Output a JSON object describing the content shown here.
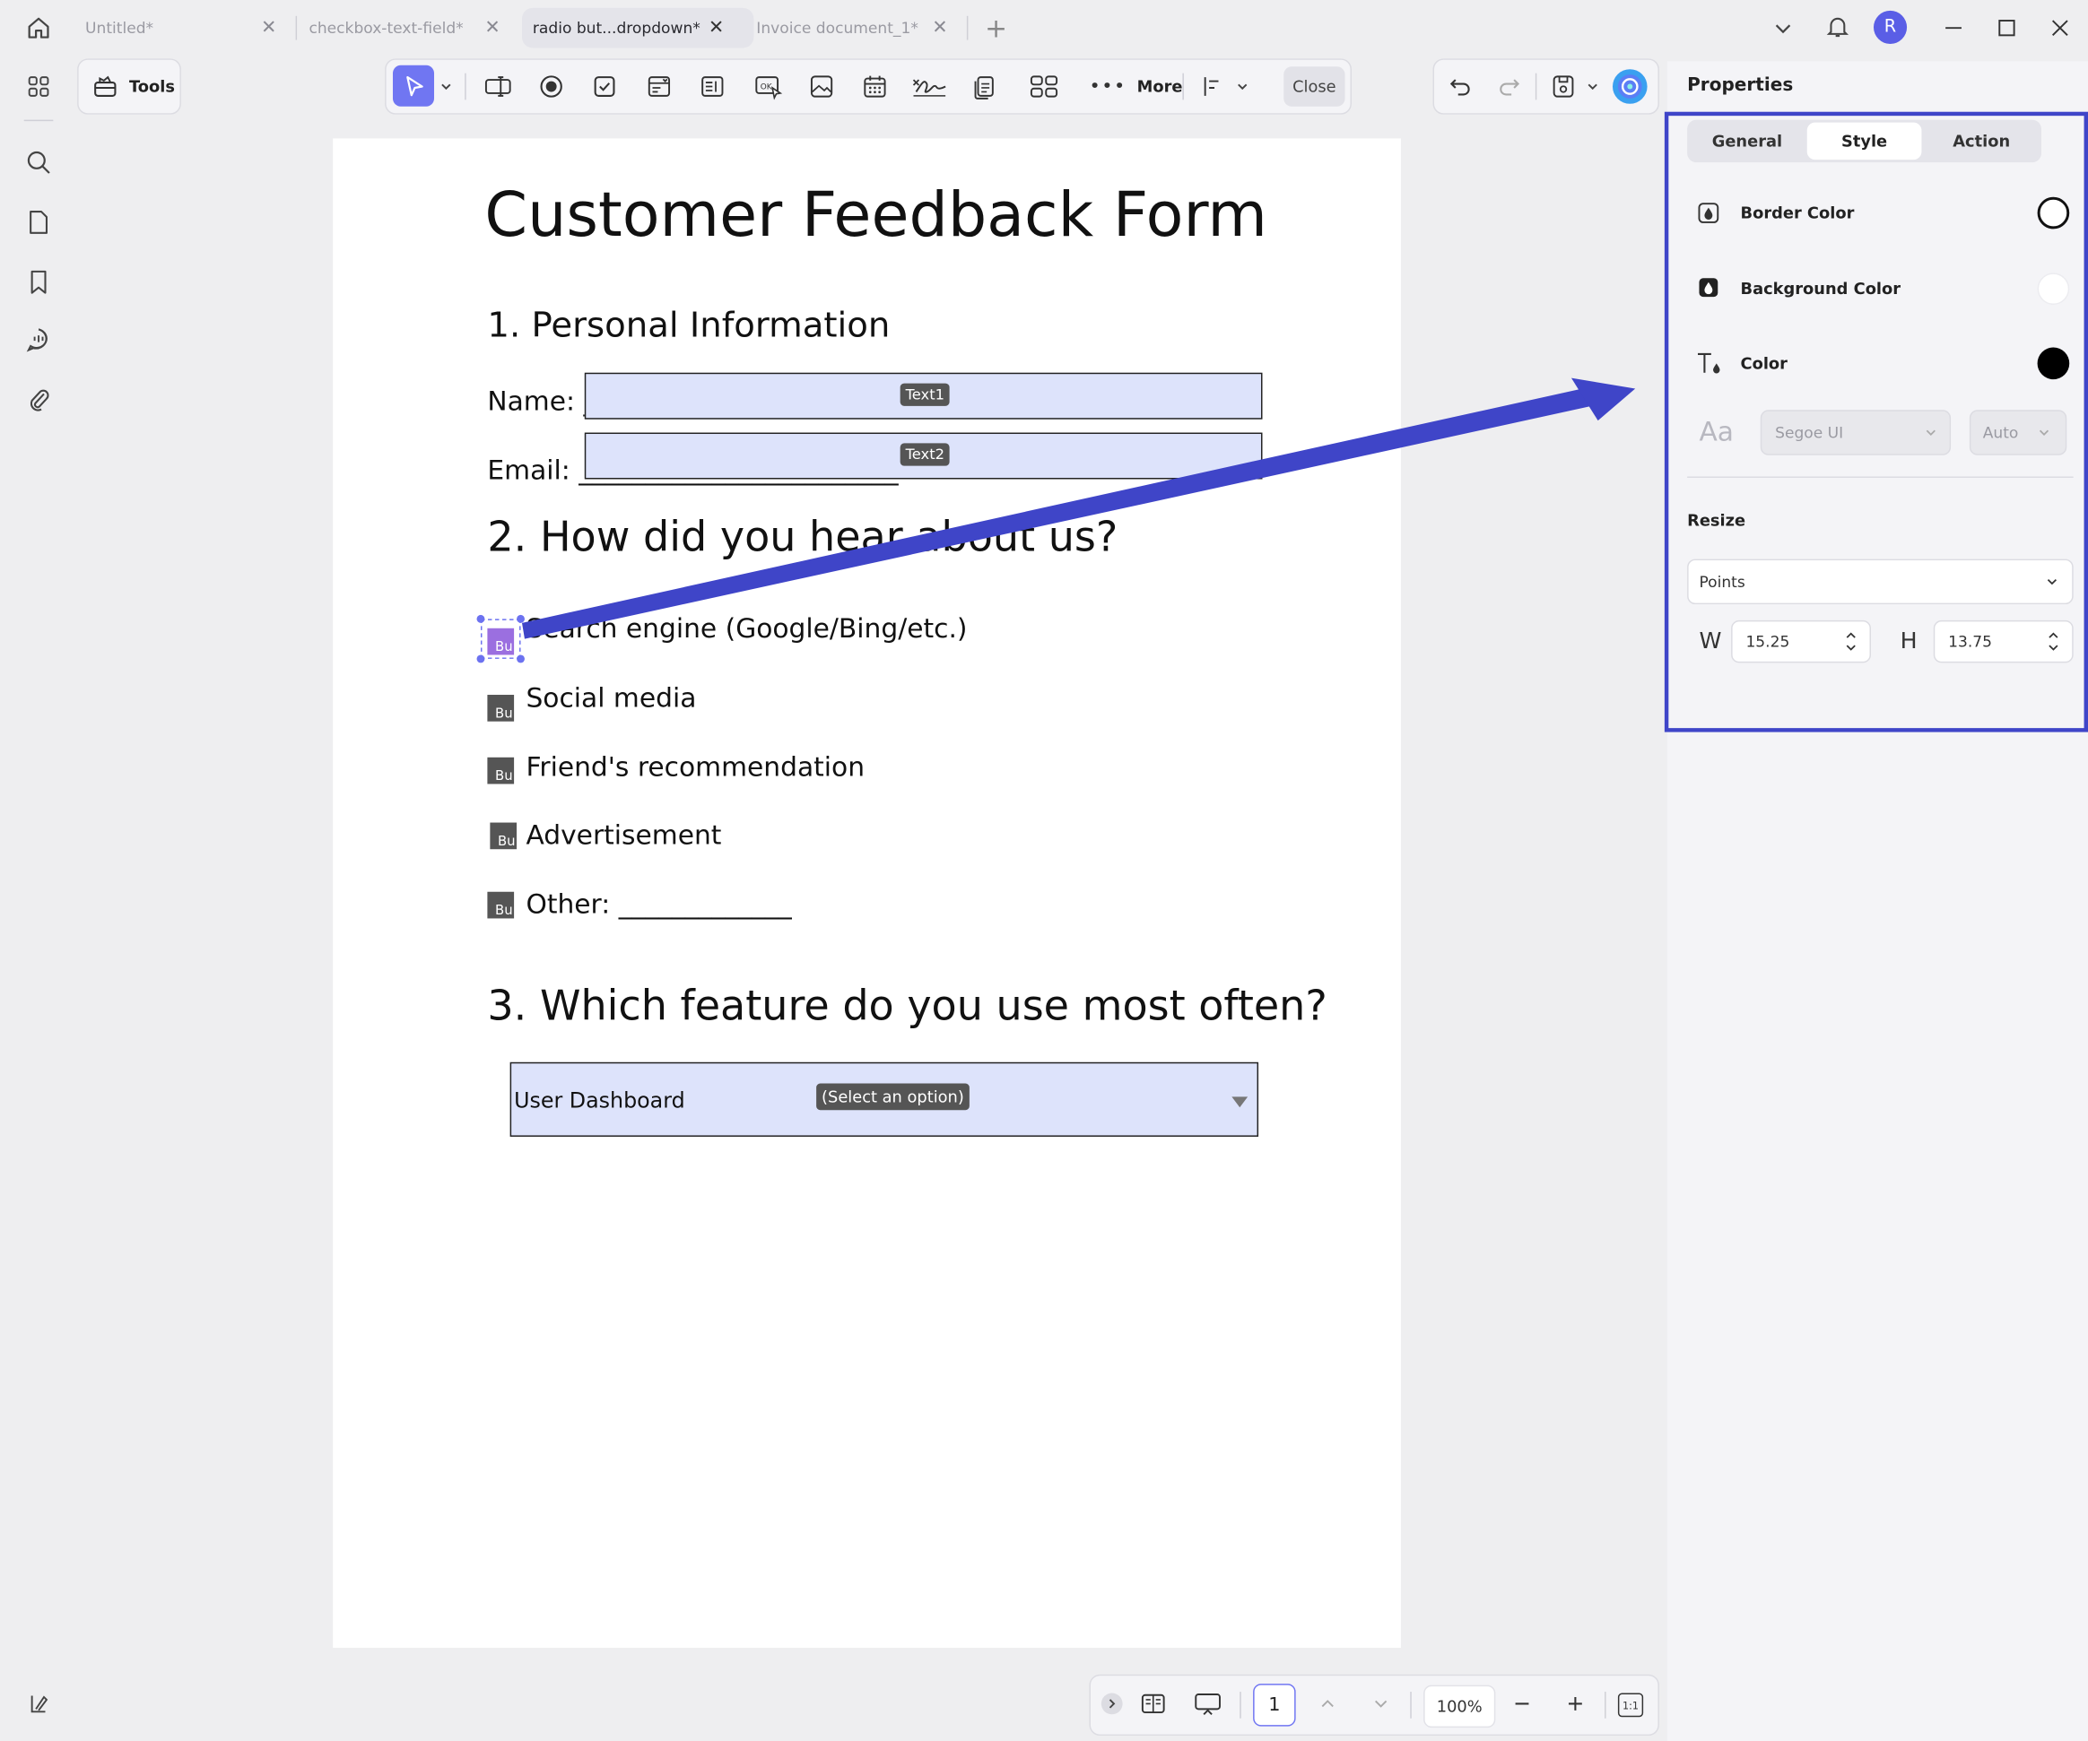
{
  "tabs": [
    {
      "label": "Untitled*"
    },
    {
      "label": "checkbox-text-field*"
    },
    {
      "label": "radio but...dropdown*"
    },
    {
      "label": "Invoice document_1*"
    }
  ],
  "user": {
    "initial": "R"
  },
  "toolbar": {
    "tools_label": "Tools",
    "more_label": "More",
    "close_label": "Close"
  },
  "document": {
    "title": "Customer Feedback Form",
    "section1": "1. Personal Information",
    "name_label": "Name: _",
    "email_label": "Email: ________________________",
    "text1_tag": "Text1",
    "text2_tag": "Text2",
    "section2": "2. How did you hear about us?",
    "options": [
      "Search engine (Google/Bing/etc.)",
      "Social media",
      "Friend's recommendation",
      "Advertisement",
      "Other: _____________"
    ],
    "radio_tag": "Bu",
    "section3": "3. Which feature do you use most often?",
    "dropdown_value": "User Dashboard",
    "dropdown_tag": "(Select an option)"
  },
  "properties": {
    "title": "Properties",
    "tabs": [
      "General",
      "Style",
      "Action"
    ],
    "active_tab": "Style",
    "border_color_label": "Border Color",
    "background_color_label": "Background Color",
    "color_label": "Color",
    "font_icon_text": "Aa",
    "font_value": "Segoe UI",
    "font_size_value": "Auto",
    "resize_label": "Resize",
    "units_value": "Points",
    "w_label": "W",
    "w_value": "15.25",
    "h_label": "H",
    "h_value": "13.75",
    "colors": {
      "border": "#ffffff",
      "background": "#ffffff",
      "text": "#000000"
    }
  },
  "bottom_bar": {
    "page_number": "1",
    "zoom": "100%",
    "fit_label": "1:1"
  },
  "colors": {
    "accent": "#6c72f0",
    "annotation": "#3f45c8",
    "field": "#dde3fb"
  }
}
